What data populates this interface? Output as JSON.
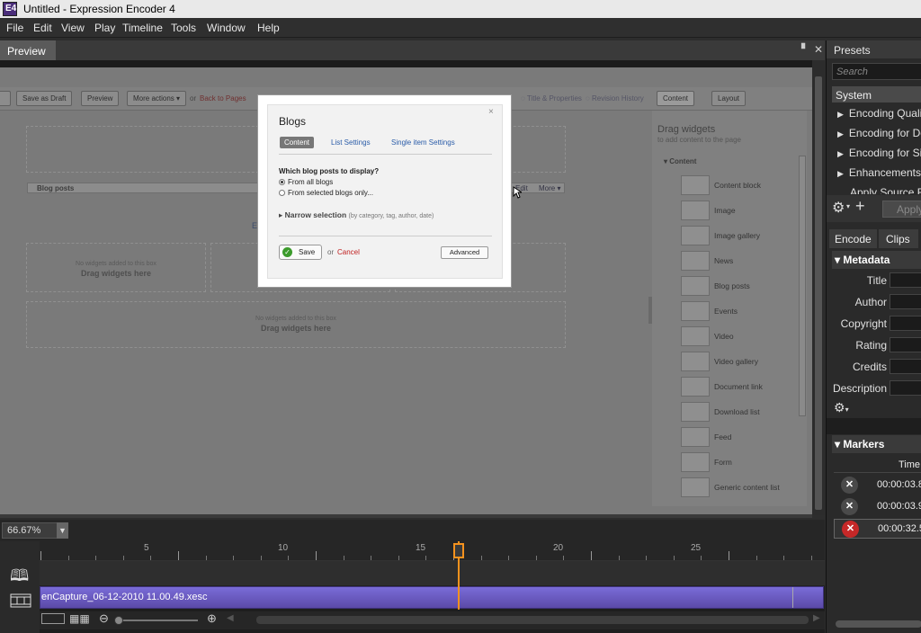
{
  "window": {
    "title": "Untitled - Expression Encoder 4"
  },
  "menu": [
    "File",
    "Edit",
    "View",
    "Play",
    "Timeline",
    "Tools",
    "Window",
    "Help"
  ],
  "preview": {
    "tab": "Preview",
    "webpage": {
      "buttons": {
        "save_draft": "Save as Draft",
        "preview": "Preview",
        "more_actions": "More actions ▾"
      },
      "or": "or",
      "back_link": "Back to Pages",
      "title_properties": "Title & Properties",
      "revision_history": "Revision History",
      "content_btn": "Content",
      "layout_btn": "Layout",
      "blog_posts_bar": "Blog posts",
      "edit": "Edit",
      "more": "More ▾",
      "e_letter": "E",
      "empty_note": "No widgets added to this box",
      "drag_here": "Drag widgets here",
      "sidebar": {
        "title": "Drag widgets",
        "subtitle": "to add content to the page",
        "section": "Content",
        "items": [
          "Content block",
          "Image",
          "Image gallery",
          "News",
          "Blog posts",
          "Events",
          "Video",
          "Video gallery",
          "Document link",
          "Download list",
          "Feed",
          "Form",
          "Generic content list"
        ]
      }
    },
    "dialog": {
      "title": "Blogs",
      "close": "×",
      "tabs": {
        "content": "Content",
        "list_settings": "List Settings",
        "single_item": "Single item Settings"
      },
      "question": "Which blog posts to display?",
      "option1": "From all blogs",
      "option2": "From selected blogs only...",
      "narrow": "Narrow selection",
      "narrow_hint": "(by category, tag, author, date)",
      "save": "Save",
      "or": "or",
      "cancel": "Cancel",
      "advanced": "Advanced"
    }
  },
  "zoom": {
    "value": "66.67%"
  },
  "timeline": {
    "ruler_labels": [
      "5",
      "10",
      "15",
      "20",
      "25"
    ],
    "clip_name": "enCapture_06-12-2010 11.00.49.xesc",
    "playhead_seconds": 15.2
  },
  "right_panel": {
    "presets_header": "Presets",
    "search_placeholder": "Search",
    "system_header": "System",
    "tree_items": [
      "Encoding Quali",
      "Encoding for De",
      "Encoding for Si",
      "Enhancements"
    ],
    "apply_source": "Apply Source Fr",
    "apply_btn": "Apply",
    "tabs": {
      "encode": "Encode",
      "clips": "Clips"
    },
    "metadata_header": "Metadata",
    "metadata_fields": [
      "Title",
      "Author",
      "Copyright",
      "Rating",
      "Credits",
      "Description"
    ],
    "markers_header": "Markers",
    "markers_time_col": "Time",
    "markers": [
      "00:00:03.8",
      "00:00:03.9",
      "00:00:32.5"
    ]
  },
  "colors": {
    "playhead": "#f5921e",
    "clip": "#6a5ac8",
    "delete_marker": "#c62828"
  }
}
